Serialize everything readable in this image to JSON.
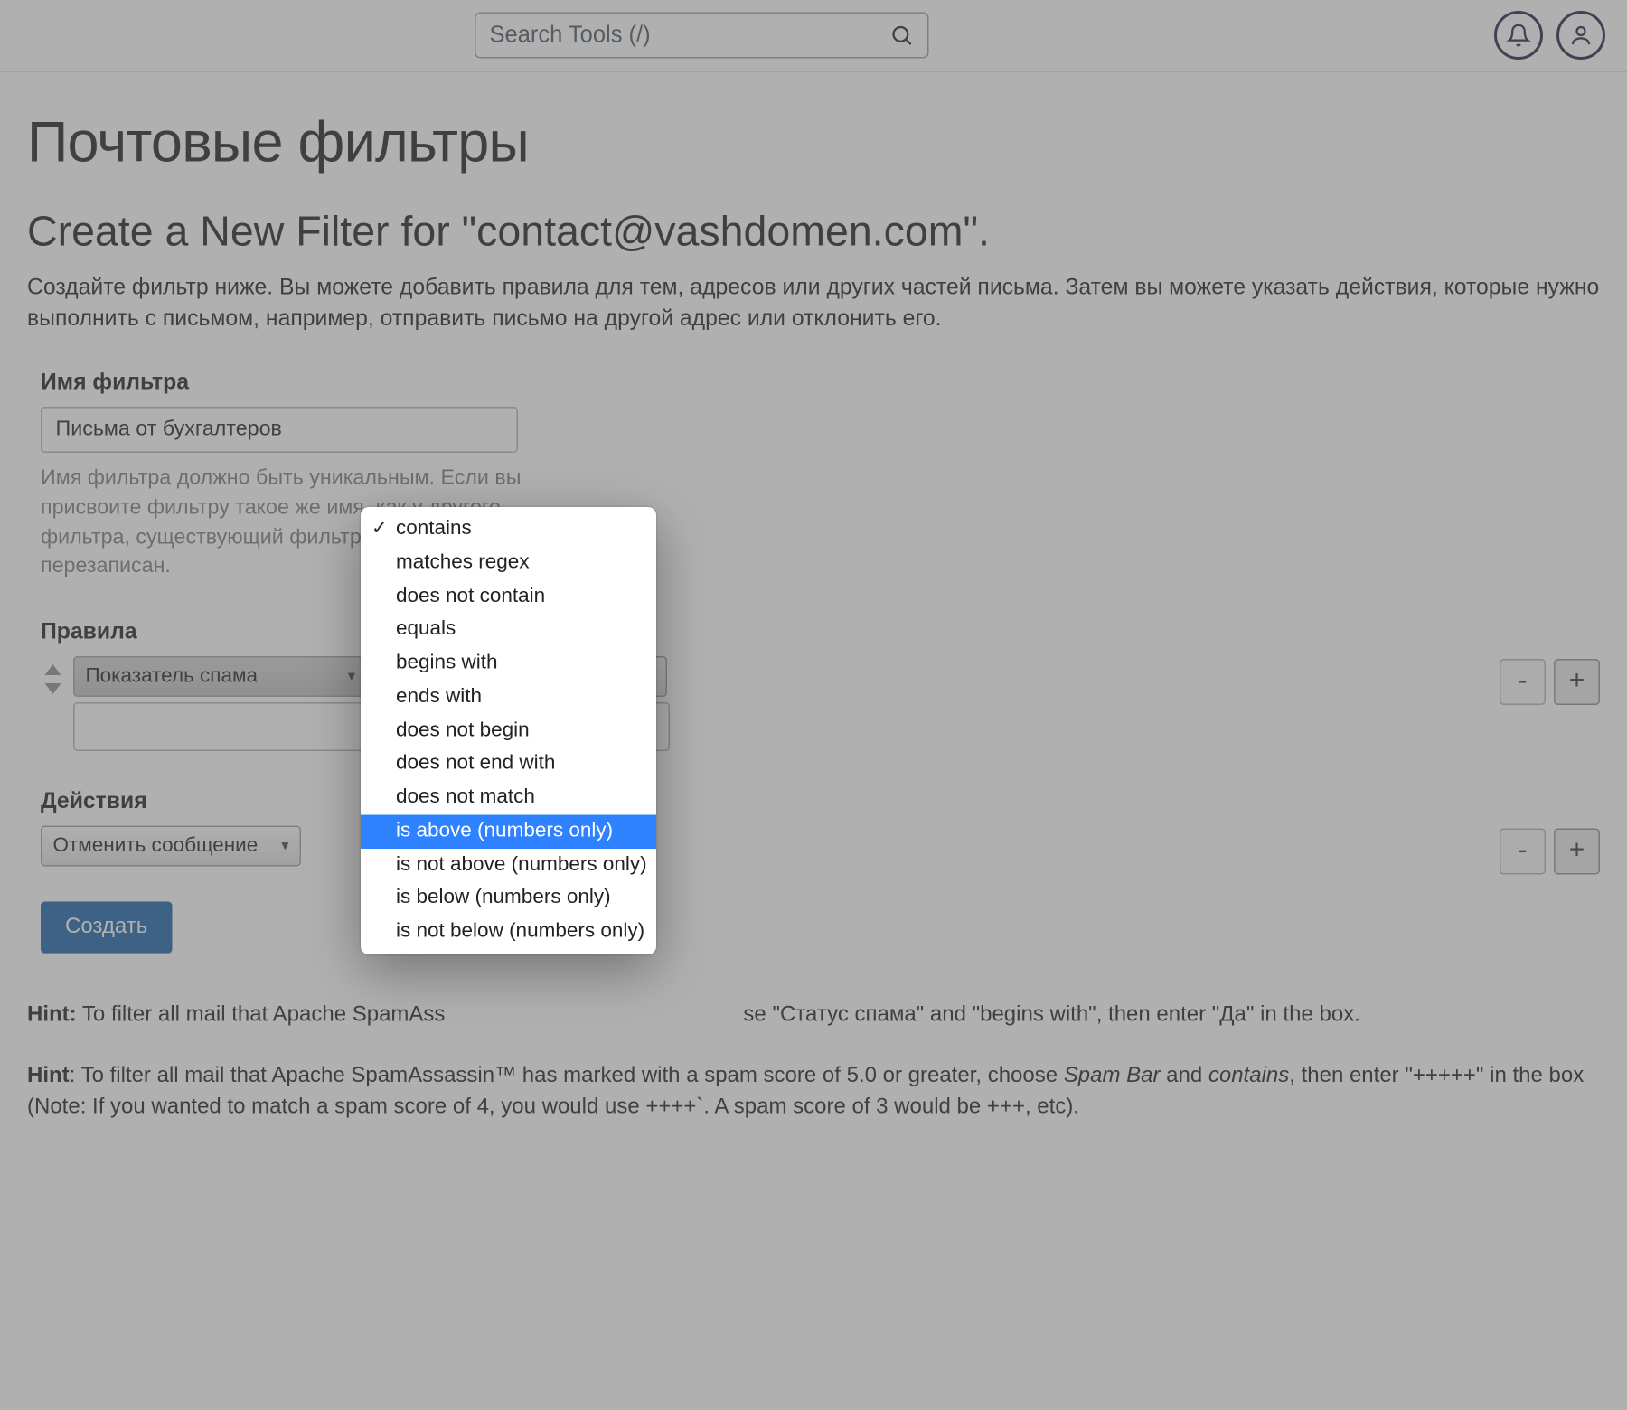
{
  "header": {
    "search_placeholder": "Search Tools (/)"
  },
  "page": {
    "title": "Почтовые фильтры",
    "subtitle": "Create a New Filter for \"contact@vashdomen.com\".",
    "description": "Создайте фильтр ниже. Вы можете добавить правила для тем, адресов или других частей письма. Затем вы можете указать действия, которые нужно выполнить с письмом, например, отправить письмо на другой адрес или отклонить его."
  },
  "filter_name": {
    "label": "Имя фильтра",
    "value": "Письма от бухгалтеров",
    "helper": "Имя фильтра должно быть уникальным. Если вы присвоите фильтру такое же имя, как у другого фильтра, существующий фильтр будет перезаписан."
  },
  "rules": {
    "label": "Правила",
    "part_selected": "Показатель спама",
    "value": "",
    "operator_options": [
      {
        "label": "contains",
        "checked": true,
        "highlight": false
      },
      {
        "label": "matches regex",
        "checked": false,
        "highlight": false
      },
      {
        "label": "does not contain",
        "checked": false,
        "highlight": false
      },
      {
        "label": "equals",
        "checked": false,
        "highlight": false
      },
      {
        "label": "begins with",
        "checked": false,
        "highlight": false
      },
      {
        "label": "ends with",
        "checked": false,
        "highlight": false
      },
      {
        "label": "does not begin",
        "checked": false,
        "highlight": false
      },
      {
        "label": "does not end with",
        "checked": false,
        "highlight": false
      },
      {
        "label": "does not match",
        "checked": false,
        "highlight": false
      },
      {
        "label": "is above (numbers only)",
        "checked": false,
        "highlight": true
      },
      {
        "label": "is not above (numbers only)",
        "checked": false,
        "highlight": false
      },
      {
        "label": "is below (numbers only)",
        "checked": false,
        "highlight": false
      },
      {
        "label": "is not below (numbers only)",
        "checked": false,
        "highlight": false
      }
    ],
    "minus": "-",
    "plus": "+"
  },
  "actions": {
    "label": "Действия",
    "selected": "Отменить сообщение",
    "minus": "-",
    "plus": "+"
  },
  "create_label": "Создать",
  "hints": {
    "h1_lead": "Hint:",
    "h1_a": " To filter all mail that Apache SpamAss",
    "h1_b": "se \"Статус спама\" and \"begins with\", then enter \"Да\" in the box.",
    "h2_lead": "Hint",
    "h2_body_a": ": To filter all mail that Apache SpamAssassin™ has marked with a spam score of 5.0 or greater, choose ",
    "h2_em1": "Spam Bar",
    "h2_body_b": " and ",
    "h2_em2": "contains",
    "h2_body_c": ", then enter \"+++++\" in the box (Note: If you wanted to match a spam score of 4, you would use ++++`. A spam score of 3 would be +++, etc)."
  }
}
